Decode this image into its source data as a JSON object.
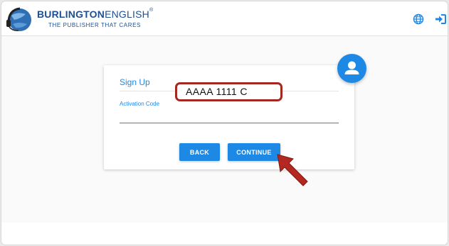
{
  "header": {
    "brand_bold": "BURLINGTON",
    "brand_light": "ENGLISH",
    "brand_mark": "®",
    "tagline": "THE PUBLISHER THAT CARES",
    "icons": [
      "globe-icon",
      "sign-in-icon",
      "user-icon"
    ]
  },
  "card": {
    "title": "Sign Up",
    "field_label": "Activation Code",
    "field_value": "",
    "back_label": "BACK",
    "continue_label": "CONTINUE"
  },
  "annotation": {
    "callout_text": "AAAA 1111 C"
  },
  "colors": {
    "accent": "#1e88e5",
    "brand": "#1d4f91",
    "callout_border": "#a5271f",
    "arrow": "#b32820"
  }
}
